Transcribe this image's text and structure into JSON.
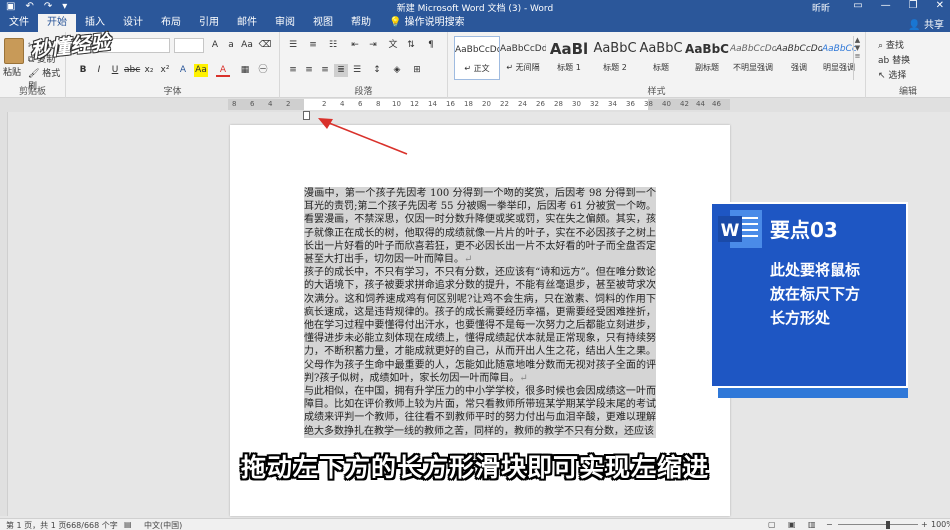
{
  "titlebar": {
    "doc_title": "新建 Microsoft Word 文档 (3) - Word",
    "user": "昕昕",
    "quick_access": [
      "↶",
      "↷",
      "▾"
    ]
  },
  "tabs": [
    "文件",
    "开始",
    "插入",
    "设计",
    "布局",
    "引用",
    "邮件",
    "审阅",
    "视图",
    "帮助",
    "操作说明搜索"
  ],
  "active_tab": "开始",
  "share_label": "共享",
  "ribbon": {
    "clipboard": {
      "paste": "粘贴",
      "cut": "剪切",
      "copy": "复制",
      "format_painter": "格式刷",
      "label": "剪贴板"
    },
    "font": {
      "label": "字体",
      "buttons": [
        "B",
        "I",
        "U",
        "abc",
        "x₂",
        "x²",
        "A",
        "Aa",
        "A"
      ]
    },
    "paragraph": {
      "label": "段落"
    },
    "styles": {
      "label": "样式",
      "items": [
        {
          "sample": "AaBbCcDd",
          "name": "↵ 正文"
        },
        {
          "sample": "AaBbCcDd",
          "name": "↵ 无间隔"
        },
        {
          "sample": "AaBl",
          "name": "标题 1"
        },
        {
          "sample": "AaBbC",
          "name": "标题 2"
        },
        {
          "sample": "AaBbC",
          "name": "标题"
        },
        {
          "sample": "AaBbC",
          "name": "副标题"
        },
        {
          "sample": "AaBbCcDd",
          "name": "不明显强调"
        },
        {
          "sample": "AaBbCcDd",
          "name": "强调"
        },
        {
          "sample": "AaBbCcDd",
          "name": "明显强调"
        }
      ]
    },
    "editing": {
      "label": "编辑",
      "find": "查找",
      "replace": "替换",
      "select": "选择"
    }
  },
  "ruler": {
    "ticks": [
      "8",
      "6",
      "4",
      "2",
      "2",
      "4",
      "6",
      "8",
      "10",
      "12",
      "14",
      "16",
      "18",
      "20",
      "22",
      "24",
      "26",
      "28",
      "30",
      "32",
      "34",
      "36",
      "38",
      "40",
      "42",
      "44",
      "46",
      "48"
    ]
  },
  "document": {
    "paragraphs": [
      "漫画中，第一个孩子先因考 100 分得到一个吻的奖赏，后因考 98 分得到一个耳光的责罚;第二个孩子先因考 55 分被赐一拳举印，后因考 61 分被赏一个吻。看罢漫画，不禁深思，仅因一时分数升降便或奖或罚，实在失之偏颇。其实，孩子就像正在成长的树，他取得的成绩就像一片片的叶子，实在不必因孩子之树上长出一片好看的叶子而欣喜若狂，更不必因长出一片不太好看的叶子而全盘否定甚至大打出手，切勿因一叶而障目。",
      "孩子的成长中，不只有学习，不只有分数，还应该有“诗和远方”。但在唯分数论的大语境下，孩子被要求拼命追求分数的提升，不能有丝毫退步，甚至被苛求次次满分。这和饲养速成鸡有何区别呢?让鸡不会生病，只在激素、饲料的作用下疯长速成，这是违背规律的。孩子的成长需要经历幸福，更需要经受困难挫折，他在学习过程中要懂得付出汗水，也要懂得不是每一次努力之后都能立刻进步，懂得进步未必能立刻体现在成绩上，懂得成绩起伏本就是正常现象，只有持续努力，不断积蓄力量，才能成就更好的自己，从而开出人生之花，结出人生之果。父母作为孩子生命中最重要的人，怎能如此随意地唯分数而无视对孩子全面的评判?孩子似树，成绩如叶，家长勿因一叶而障目。",
      "与此相似，在中国，拥有升学压力的中小学学校，很多时候也会因成绩这一叶而障目。比如在评价教师上较为片面，常只看教师所带班某学期某学段末尾的考试成绩来评判一个教师，往往看不到教师平时的努力付出与血泪辛酸，更难以理解绝大多数挣扎在教学一线的教师之苦，同样的，教师的教学不只有分数，还应该"
    ],
    "para_mark": "↵"
  },
  "overlay": {
    "badge_letter": "W",
    "heading": "要点03",
    "lines": [
      "此处要将鼠标",
      "放在标尺下方",
      "长方形处"
    ]
  },
  "subtitle": "拖动左下方的长方形滑块即可实现左缩进",
  "watermark": "秒懂经验",
  "statusbar": {
    "page": "第 1 页，共 1 页",
    "words": "668/668 个字",
    "language": "中文(中国)",
    "zoom": "100%"
  },
  "colors": {
    "ribbon_blue": "#2b579a",
    "overlay_blue": "#1e56c3",
    "arrow_red": "#d9312b"
  }
}
